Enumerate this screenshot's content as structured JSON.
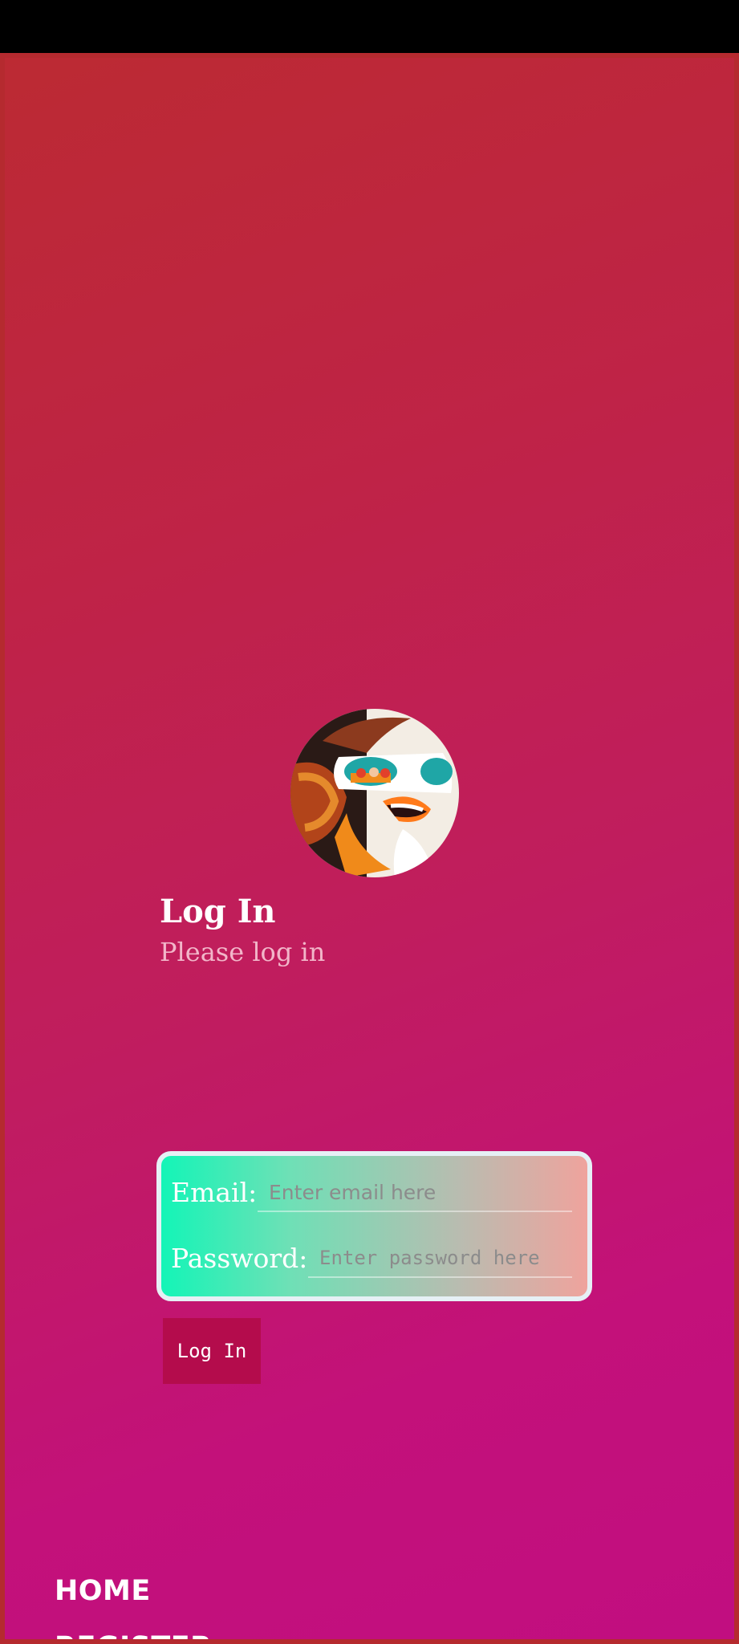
{
  "page": {
    "title": "Log In",
    "subtitle": "Please log in"
  },
  "form": {
    "email": {
      "label": "Email:",
      "placeholder": "Enter email here",
      "value": ""
    },
    "password": {
      "label": "Password:",
      "placeholder": "Enter password here",
      "value": ""
    },
    "submit_label": "Log In"
  },
  "nav": {
    "items": [
      {
        "label": "HOME"
      },
      {
        "label": "REGISTER"
      }
    ]
  },
  "avatar": {
    "icon": "avatar-illustration-woman-sunglasses"
  },
  "colors": {
    "gradient_top": "#bc2a33",
    "gradient_bottom": "#c10e80",
    "button_bg": "#b40c4c",
    "card_left": "#13f5b7",
    "card_right": "#efa39d",
    "subtitle": "#f2b6c9"
  }
}
